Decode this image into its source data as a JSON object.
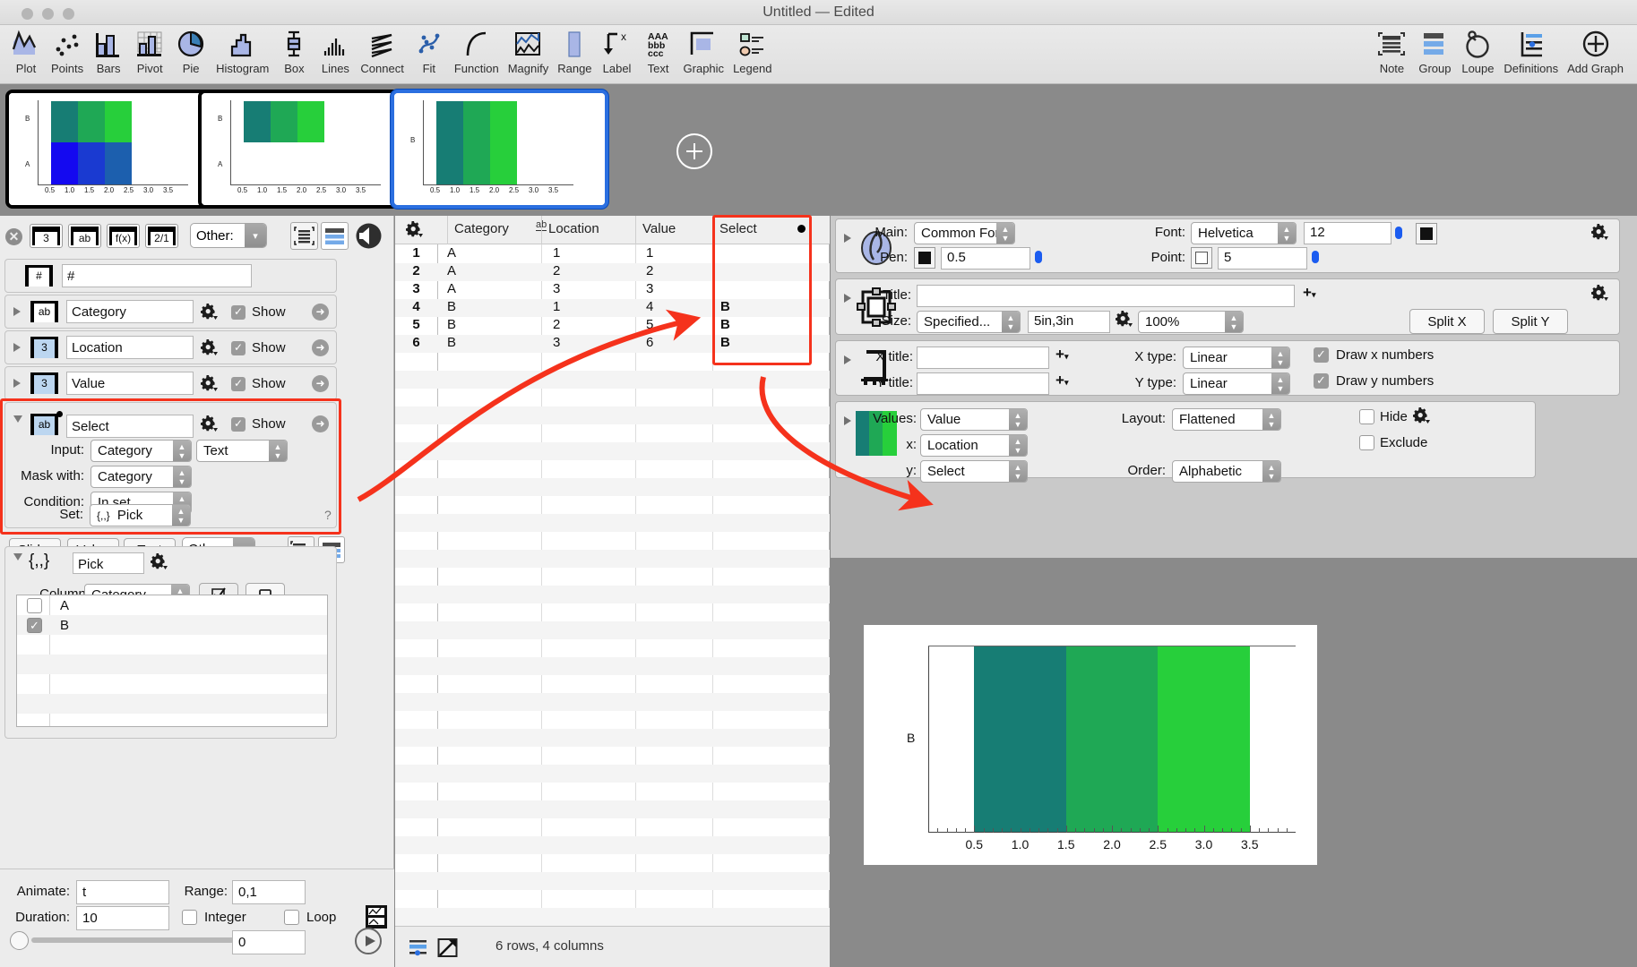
{
  "window": {
    "title": "Untitled — Edited",
    "traffic_lights": [
      "close",
      "minimize",
      "zoom"
    ]
  },
  "toolbar": {
    "left_items": [
      {
        "label": "Plot",
        "icon": "plot-icon"
      },
      {
        "label": "Points",
        "icon": "points-icon"
      },
      {
        "label": "Bars",
        "icon": "bars-icon"
      },
      {
        "label": "Pivot",
        "icon": "pivot-icon"
      },
      {
        "label": "Pie",
        "icon": "pie-icon"
      },
      {
        "label": "Histogram",
        "icon": "histogram-icon"
      },
      {
        "label": "Box",
        "icon": "box-icon"
      },
      {
        "label": "Lines",
        "icon": "lines-icon"
      },
      {
        "label": "Connect",
        "icon": "connect-icon"
      },
      {
        "label": "Fit",
        "icon": "fit-icon"
      },
      {
        "label": "Function",
        "icon": "function-icon"
      },
      {
        "label": "Magnify",
        "icon": "magnify-icon"
      },
      {
        "label": "Range",
        "icon": "range-icon"
      },
      {
        "label": "Label",
        "icon": "label-icon"
      },
      {
        "label": "Text",
        "icon": "text-icon"
      },
      {
        "label": "Graphic",
        "icon": "graphic-icon"
      },
      {
        "label": "Legend",
        "icon": "legend-icon"
      }
    ],
    "right_items": [
      {
        "label": "Note",
        "icon": "note-icon"
      },
      {
        "label": "Group",
        "icon": "group-icon"
      },
      {
        "label": "Loupe",
        "icon": "loupe-icon"
      },
      {
        "label": "Definitions",
        "icon": "definitions-icon"
      },
      {
        "label": "Add Graph",
        "icon": "add-graph-icon"
      }
    ]
  },
  "thumbnails": [
    {
      "name": "thumbnail-1",
      "selected": false
    },
    {
      "name": "thumbnail-2",
      "selected": false
    },
    {
      "name": "thumbnail-3",
      "selected": true
    }
  ],
  "columns_panel": {
    "type_buttons": [
      "3",
      "ab",
      "f(x)",
      "2/1"
    ],
    "other_label": "Other:",
    "rows": [
      {
        "icon": "number-column-icon",
        "icon_label": "#",
        "name": "#",
        "show": null,
        "expanded": false
      },
      {
        "icon": "text-column-icon",
        "icon_label": "ab",
        "name": "Category",
        "show": true,
        "show_label": "Show",
        "expanded": false
      },
      {
        "icon": "number-column-icon",
        "icon_label": "3",
        "name": "Location",
        "show": true,
        "show_label": "Show",
        "expanded": false
      },
      {
        "icon": "number-column-icon",
        "icon_label": "3",
        "name": "Value",
        "show": true,
        "show_label": "Show",
        "expanded": false
      },
      {
        "icon": "mask-column-icon",
        "icon_label": "ab",
        "name": "Select",
        "show": true,
        "show_label": "Show",
        "expanded": true
      }
    ],
    "select_settings": {
      "input_label": "Input:",
      "input_value": "Category",
      "input_type": "Text",
      "mask_label": "Mask with:",
      "mask_value": "Category",
      "condition_label": "Condition:",
      "condition_value": "In set",
      "set_label": "Set:",
      "set_value": "Pick",
      "set_prefix": "{,,}",
      "help": "?"
    }
  },
  "variables_panel": {
    "buttons": [
      "Slider",
      "Value",
      "Text"
    ],
    "other_label": "Other:",
    "pick": {
      "icon_label": "{,,}",
      "name": "Pick",
      "column_label": "Column:",
      "column_value": "Category",
      "items": [
        {
          "label": "A",
          "checked": false
        },
        {
          "label": "B",
          "checked": true
        }
      ]
    }
  },
  "animate_panel": {
    "animate_label": "Animate:",
    "animate_value": "t",
    "range_label": "Range:",
    "range_value": "0,1",
    "duration_label": "Duration:",
    "duration_value": "10",
    "integer_label": "Integer",
    "integer_checked": false,
    "loop_label": "Loop",
    "loop_checked": false,
    "slider_value": "0"
  },
  "table": {
    "headers": [
      "Category",
      "Location",
      "Value",
      "Select"
    ],
    "header_type_badge": "ab",
    "rows": [
      {
        "n": "1",
        "Category": "A",
        "Location": "1",
        "Value": "1",
        "Select": ""
      },
      {
        "n": "2",
        "Category": "A",
        "Location": "2",
        "Value": "2",
        "Select": ""
      },
      {
        "n": "3",
        "Category": "A",
        "Location": "3",
        "Value": "3",
        "Select": ""
      },
      {
        "n": "4",
        "Category": "B",
        "Location": "1",
        "Value": "4",
        "Select": "B"
      },
      {
        "n": "5",
        "Category": "B",
        "Location": "2",
        "Value": "5",
        "Select": "B"
      },
      {
        "n": "6",
        "Category": "B",
        "Location": "3",
        "Value": "6",
        "Select": "B"
      }
    ],
    "status": "6 rows, 4 columns"
  },
  "settings": {
    "main_section": {
      "main_label": "Main:",
      "main_value": "Common Font",
      "font_label": "Font:",
      "font_value": "Helvetica",
      "font_size": "12",
      "pen_label": "Pen:",
      "pen_value": "0.5",
      "point_label": "Point:",
      "point_value": "5"
    },
    "frame_section": {
      "title_label": "Title:",
      "title_value": "",
      "size_label": "Size:",
      "size_mode": "Specified...",
      "size_value": "5in,3in",
      "scale_value": "100%",
      "split_x": "Split X",
      "split_y": "Split Y"
    },
    "axis_section": {
      "x_title_label": "X title:",
      "x_title_value": "",
      "y_title_label": "Y title:",
      "y_title_value": "",
      "x_type_label": "X type:",
      "x_type_value": "Linear",
      "y_type_label": "Y type:",
      "y_type_value": "Linear",
      "draw_x_label": "Draw x numbers",
      "draw_x_checked": true,
      "draw_y_label": "Draw y numbers",
      "draw_y_checked": true
    },
    "pivot_section": {
      "values_label": "Values:",
      "values_value": "Value",
      "x_label": "x:",
      "x_value": "Location",
      "y_label": "y:",
      "y_value": "Select",
      "layout_label": "Layout:",
      "layout_value": "Flattened",
      "order_label": "Order:",
      "order_value": "Alphabetic",
      "hide_label": "Hide",
      "hide_checked": false,
      "exclude_label": "Exclude",
      "exclude_checked": false
    }
  },
  "colors": {
    "annotation": "#f5321c",
    "selection": "#2b6fe0",
    "bar_1": "#177d74",
    "bar_2": "#1fa855",
    "bar_3": "#27cf3b",
    "blue_1": "#1409f0",
    "blue_2": "#1a3ad1",
    "blue_3": "#1c5fae",
    "canvas_bg": "#8a8a8a",
    "panel_bg": "#ececec"
  },
  "chart_data": {
    "type": "bar",
    "title": "",
    "xlabel": "",
    "ylabel": "",
    "categories": [
      "B"
    ],
    "x": [
      1,
      2,
      3
    ],
    "xtick_labels": [
      "0.5",
      "1.0",
      "1.5",
      "2.0",
      "2.5",
      "3.0",
      "3.5"
    ],
    "xtick_values": [
      0.5,
      1.0,
      1.5,
      2.0,
      2.5,
      3.0,
      3.5
    ],
    "ytick_labels": [
      "B"
    ],
    "xlim": [
      0,
      4
    ],
    "series": [
      {
        "name": "B",
        "values": [
          4,
          5,
          6
        ],
        "colors": [
          "#177d74",
          "#1fa855",
          "#27cf3b"
        ]
      }
    ],
    "grid": false,
    "legend": "none",
    "orientation": "horizontal-bands"
  }
}
